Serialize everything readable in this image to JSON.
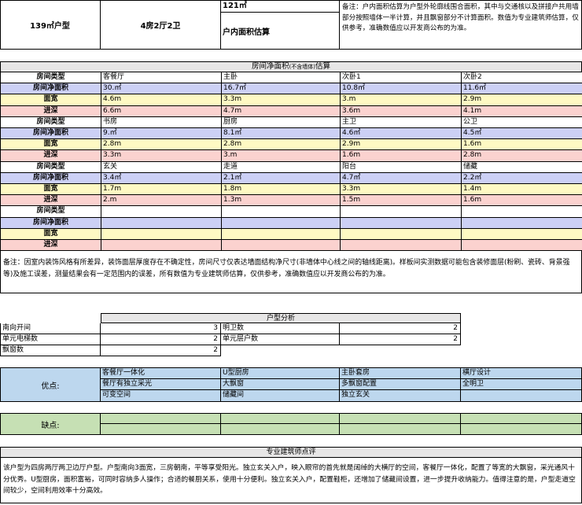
{
  "top": {
    "area": "139㎡户型",
    "layout": "4房2厅2卫",
    "size_value": "121㎡",
    "size_label": "户内面积估算",
    "note": "备注：户内面积估算为户型外轮廓线围合面积，其中与交通核以及拼接户共用墙部分按照墙体一半计算，并且飘窗部分不计算面积。数值为专业建筑师估算，仅供参考，准确数值应以开发商公布的为准。"
  },
  "rooms": {
    "title": "房间净面积",
    "title_small": "(不含墙体)",
    "title_suffix": "估算",
    "row_labels": [
      "房间类型",
      "房间净面积",
      "面宽",
      "进深"
    ],
    "groups": [
      {
        "names": [
          "客餐厅",
          "主卧",
          "次卧1",
          "次卧2"
        ],
        "areas": [
          "30.㎡",
          "16.7㎡",
          "10.8㎡",
          "11.6㎡"
        ],
        "widths": [
          "4.6m",
          "3.3m",
          "3.m",
          "2.9m"
        ],
        "depths": [
          "6.6m",
          "4.7m",
          "3.6m",
          "4.1m"
        ]
      },
      {
        "names": [
          "书房",
          "厨房",
          "主卫",
          "公卫"
        ],
        "areas": [
          "9.㎡",
          "8.1㎡",
          "4.6㎡",
          "4.5㎡"
        ],
        "widths": [
          "2.8m",
          "2.8m",
          "2.9m",
          "1.6m"
        ],
        "depths": [
          "3.3m",
          "3.m",
          "1.6m",
          "2.8m"
        ]
      },
      {
        "names": [
          "玄关",
          "走道",
          "阳台",
          "储藏"
        ],
        "areas": [
          "3.4㎡",
          "2.1㎡",
          "4.7㎡",
          "2.2㎡"
        ],
        "widths": [
          "1.7m",
          "1.8m",
          "3.3m",
          "1.4m"
        ],
        "depths": [
          "2.m",
          "1.3m",
          "1.5m",
          "1.6m"
        ]
      },
      {
        "names": [
          "",
          "",
          "",
          ""
        ],
        "areas": [
          "",
          "",
          "",
          ""
        ],
        "widths": [
          "",
          "",
          "",
          ""
        ],
        "depths": [
          "",
          "",
          "",
          ""
        ]
      }
    ],
    "note": "备注：因室内装饰风格有所差异，装饰面层厚度存在不确定性，房间尺寸仅表达墙面结构净尺寸(非墙体中心线之间的轴线距离)。样板间实测数据可能包含装修面层(粉刷、瓷砖、背景强等)及施工误差，测量结果会有一定范围内的误差，所有数值为专业建筑师估算，仅供参考，准确数值应以开发商公布的为准。"
  },
  "analysis": {
    "title": "户型分析",
    "rows": [
      {
        "l_label": "南向开间",
        "l_value": "3",
        "r_label": "明卫数",
        "r_value": "2"
      },
      {
        "l_label": "单元电梯数",
        "l_value": "2",
        "r_label": "单元层户数",
        "r_value": "2"
      },
      {
        "l_label": "飘窗数",
        "l_value": "2",
        "r_label": "",
        "r_value": ""
      }
    ]
  },
  "pros": {
    "label": "优点:",
    "rows": [
      [
        "客餐厅一体化",
        "U型厨房",
        "主卧套房",
        "横厅设计"
      ],
      [
        "餐厅有独立采光",
        "大飘窗",
        "多飘窗配置",
        "全明卫"
      ],
      [
        "可变空间",
        "储藏间",
        "独立玄关",
        ""
      ]
    ]
  },
  "cons": {
    "label": "缺点:"
  },
  "review": {
    "title": "专业建筑师点评",
    "text": "该户型为四房两厅两卫边厅户型。户型南向3面宽，三房朝南，平等享受阳光。独立玄关入户，映入眼帘的首先就是阔绰的大横厅的空间，客餐厅一体化，配置了等宽的大飘窗，采光通风十分优秀。U型厨房，面积富裕，可同时容纳多人操作；合适的餐厨关系，使用十分便利。独立玄关入户，配置鞋柜，还增加了储藏间设置，进一步提升收纳能力。值得注意的是，户型走道空间较少，空间利用效率十分高效。"
  },
  "colors": {
    "purple": "#ccd0f5",
    "yellow": "#fef9c3",
    "pink": "#fbd2cf",
    "blue": "#bdd7ee",
    "green": "#c6e0b4"
  }
}
